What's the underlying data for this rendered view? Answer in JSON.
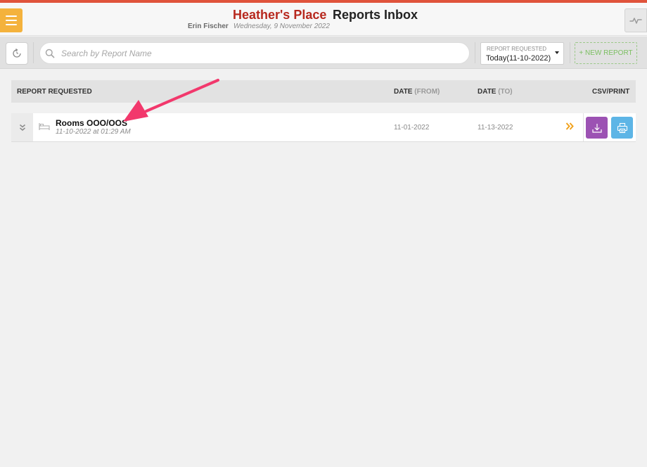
{
  "header": {
    "hotel_name": "Heather's Place",
    "page_title": "Reports Inbox",
    "user_name": "Erin Fischer",
    "current_date": "Wednesday, 9 November 2022"
  },
  "toolbar": {
    "search_placeholder": "Search by Report Name",
    "report_requested_label": "REPORT REQUESTED",
    "report_requested_value": "Today(11-10-2022)",
    "new_report_label": "+ NEW REPORT"
  },
  "table": {
    "columns": {
      "report_requested": "REPORT REQUESTED",
      "date_from": "DATE",
      "date_from_suffix": "(FROM)",
      "date_to": "DATE",
      "date_to_suffix": "(TO)",
      "csv_print": "CSV/PRINT"
    },
    "rows": [
      {
        "name": "Rooms OOO/OOS",
        "requested_at": "11-10-2022 at 01:29 AM",
        "date_from": "11-01-2022",
        "date_to": "11-13-2022"
      }
    ]
  },
  "colors": {
    "accent_red": "#b7281e",
    "menu_orange": "#f4b23c",
    "csv_purple": "#9c52b3",
    "print_blue": "#5db5e6",
    "new_report_green": "#7cbf62",
    "annotation_arrow": "#f2386c"
  },
  "icons": {
    "menu": "hamburger-icon",
    "activity": "pulse-icon",
    "refresh": "refresh-icon",
    "search": "search-icon",
    "expand": "double-chevron-down-icon",
    "room": "bed-icon",
    "open": "double-chevron-right-icon",
    "csv": "download-icon",
    "print": "printer-icon"
  }
}
